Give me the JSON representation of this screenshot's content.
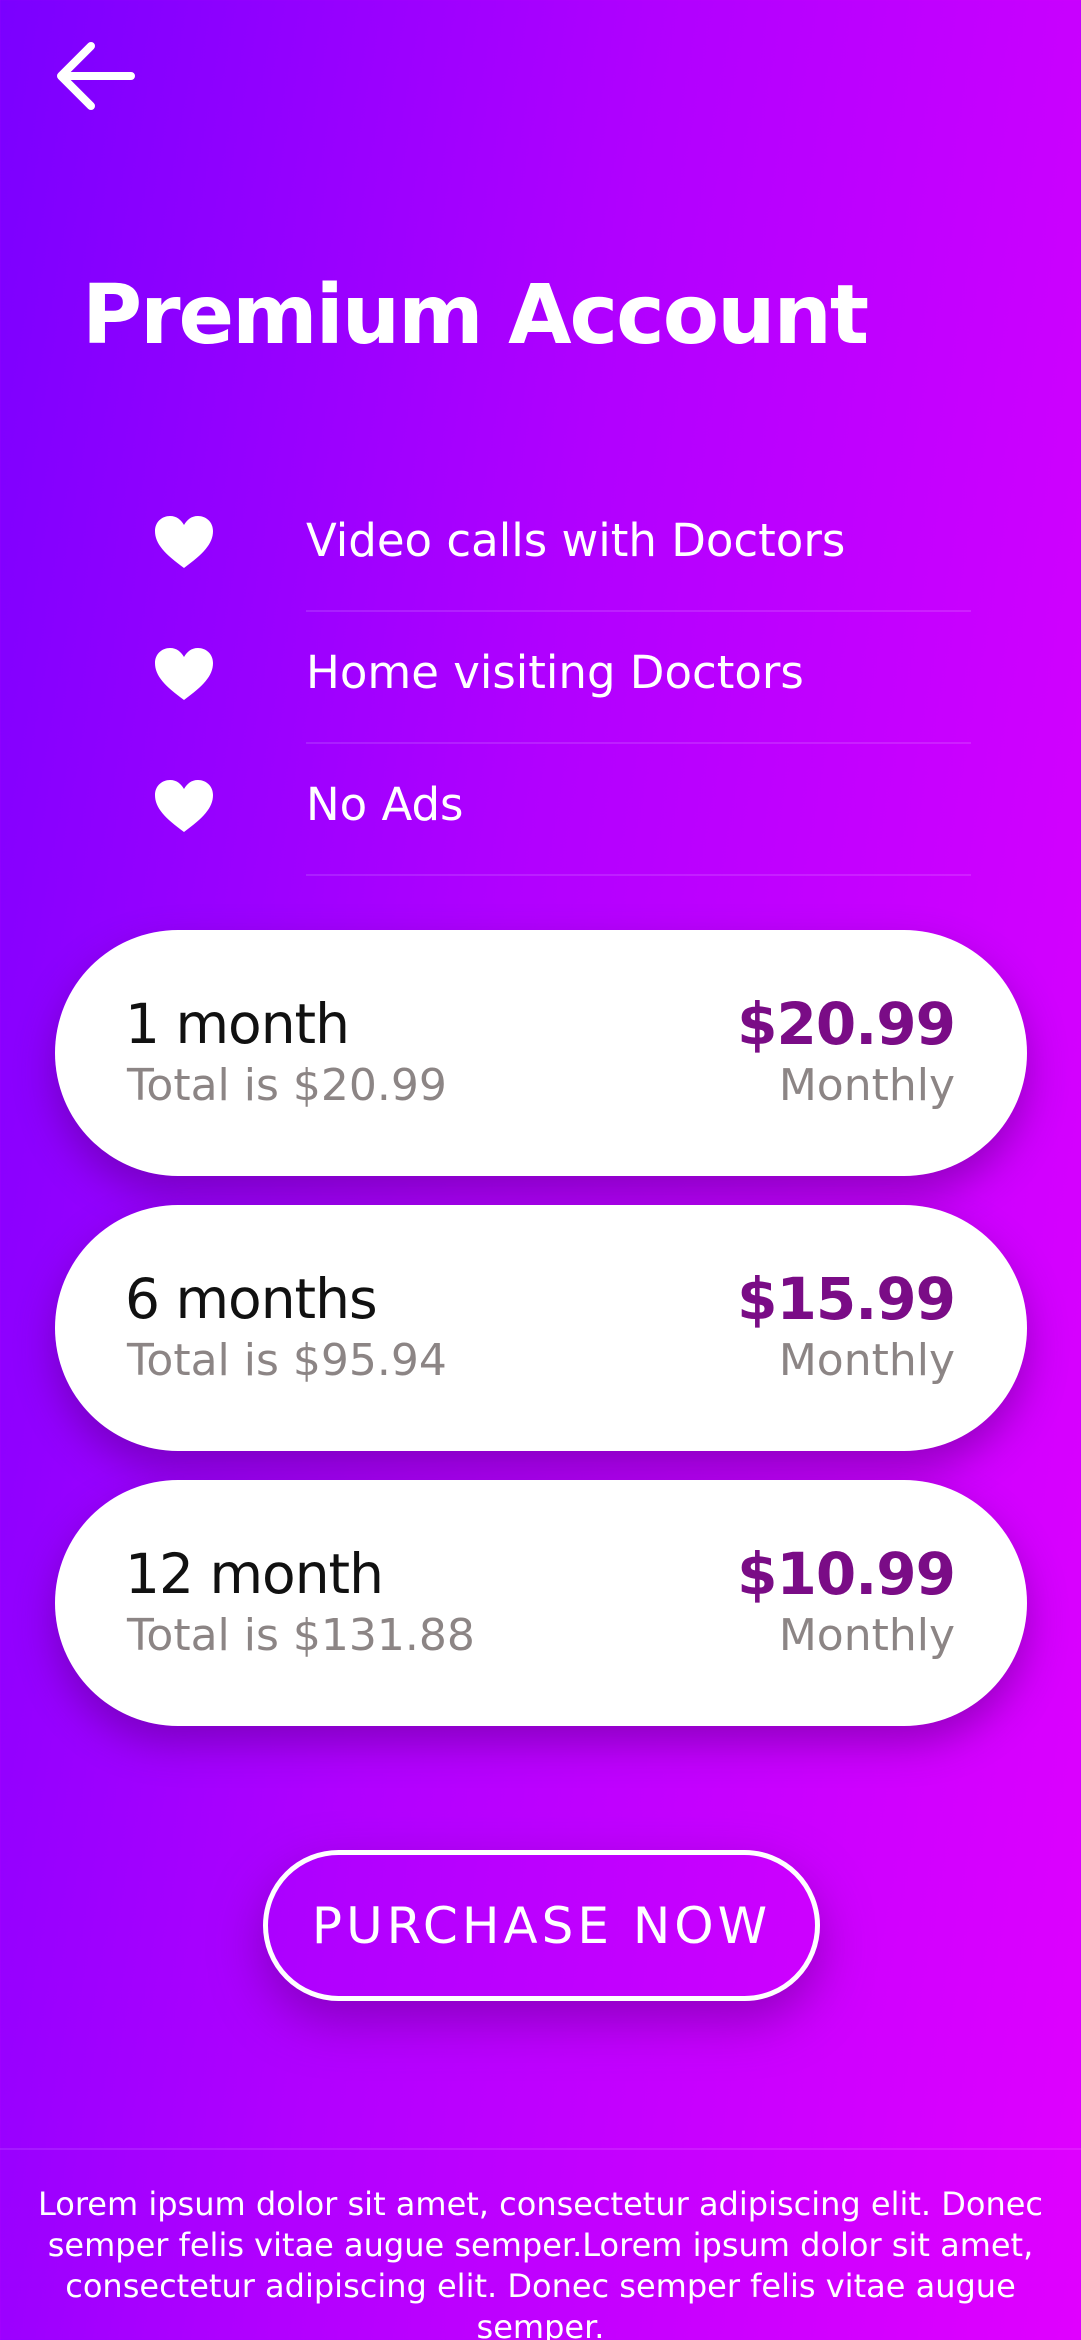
{
  "header": {
    "back_icon": "arrow-left-icon",
    "title": "Premium Account"
  },
  "features": [
    {
      "icon": "heart-icon",
      "label": "Video calls with Doctors"
    },
    {
      "icon": "heart-icon",
      "label": "Home visiting Doctors"
    },
    {
      "icon": "heart-icon",
      "label": "No Ads"
    }
  ],
  "plans": [
    {
      "duration": "1 month",
      "total": "Total is $20.99",
      "price": "$20.99",
      "period": "Monthly"
    },
    {
      "duration": "6 months",
      "total": "Total is $95.94",
      "price": "$15.99",
      "period": "Monthly"
    },
    {
      "duration": "12 month",
      "total": "Total is $131.88",
      "price": "$10.99",
      "period": "Monthly"
    }
  ],
  "purchase": {
    "label": "PURCHASE NOW"
  },
  "footer": {
    "text": "Lorem ipsum dolor sit amet, consectetur adipiscing elit. Donec semper felis vitae augue semper.Lorem ipsum dolor sit amet, consectetur adipiscing elit. Donec semper felis vitae augue semper."
  },
  "colors": {
    "gradient_start": "#7a00ff",
    "gradient_end": "#e000ff",
    "price": "#7a0c86",
    "muted_text": "#8c8585"
  }
}
